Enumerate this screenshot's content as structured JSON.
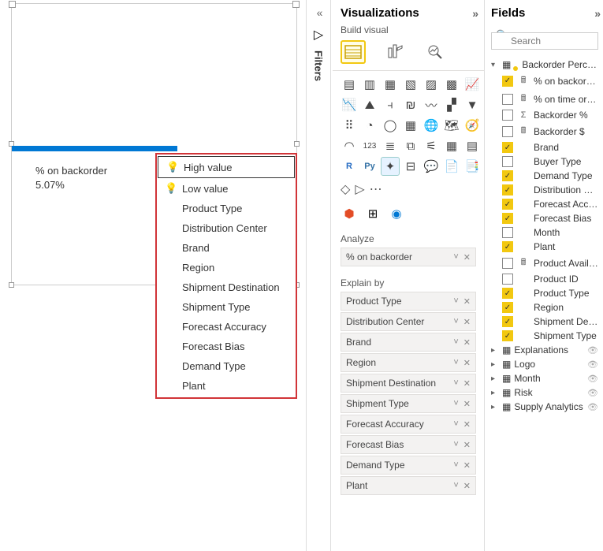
{
  "visual": {
    "kpi_label": "% on backorder",
    "kpi_value": "5.07%"
  },
  "menu": {
    "items": [
      {
        "label": "High value",
        "bulb": true,
        "selected": true
      },
      {
        "label": "Low value",
        "bulb": true
      },
      {
        "label": "Product Type"
      },
      {
        "label": "Distribution Center"
      },
      {
        "label": "Brand"
      },
      {
        "label": "Region"
      },
      {
        "label": "Shipment Destination"
      },
      {
        "label": "Shipment Type"
      },
      {
        "label": "Forecast Accuracy"
      },
      {
        "label": "Forecast Bias"
      },
      {
        "label": "Demand Type"
      },
      {
        "label": "Plant"
      }
    ]
  },
  "filters": {
    "label": "Filters"
  },
  "viz": {
    "title": "Visualizations",
    "subtitle": "Build visual",
    "analyze_label": "Analyze",
    "analyze_well": "% on backorder",
    "explain_label": "Explain by",
    "explain_wells": [
      "Product Type",
      "Distribution Center",
      "Brand",
      "Region",
      "Shipment Destination",
      "Shipment Type",
      "Forecast Accuracy",
      "Forecast Bias",
      "Demand Type",
      "Plant"
    ]
  },
  "fields": {
    "title": "Fields",
    "search_placeholder": "Search",
    "tables": [
      {
        "name": "Backorder Percentage",
        "expanded": true,
        "highlighted": true,
        "fields": [
          {
            "name": "% on backorder",
            "checked": true,
            "type": "calc"
          },
          {
            "name": "% on time orders",
            "checked": false,
            "type": "calc"
          },
          {
            "name": "Backorder %",
            "checked": false,
            "type": "sum"
          },
          {
            "name": "Backorder $",
            "checked": false,
            "type": "calc"
          },
          {
            "name": "Brand",
            "checked": true,
            "type": ""
          },
          {
            "name": "Buyer Type",
            "checked": false,
            "type": ""
          },
          {
            "name": "Demand Type",
            "checked": true,
            "type": ""
          },
          {
            "name": "Distribution Cent...",
            "checked": true,
            "type": ""
          },
          {
            "name": "Forecast Accuracy",
            "checked": true,
            "type": ""
          },
          {
            "name": "Forecast Bias",
            "checked": true,
            "type": ""
          },
          {
            "name": "Month",
            "checked": false,
            "type": ""
          },
          {
            "name": "Plant",
            "checked": true,
            "type": ""
          },
          {
            "name": "Product Availabil...",
            "checked": false,
            "type": "calc"
          },
          {
            "name": "Product ID",
            "checked": false,
            "type": ""
          },
          {
            "name": "Product Type",
            "checked": true,
            "type": ""
          },
          {
            "name": "Region",
            "checked": true,
            "type": ""
          },
          {
            "name": "Shipment Destin...",
            "checked": true,
            "type": ""
          },
          {
            "name": "Shipment Type",
            "checked": true,
            "type": ""
          }
        ]
      },
      {
        "name": "Explanations",
        "expanded": false,
        "hidden": true
      },
      {
        "name": "Logo",
        "expanded": false,
        "hidden": true
      },
      {
        "name": "Month",
        "expanded": false,
        "hidden": true
      },
      {
        "name": "Risk",
        "expanded": false,
        "hidden": true
      },
      {
        "name": "Supply Analytics",
        "expanded": false,
        "hidden": true
      }
    ]
  }
}
